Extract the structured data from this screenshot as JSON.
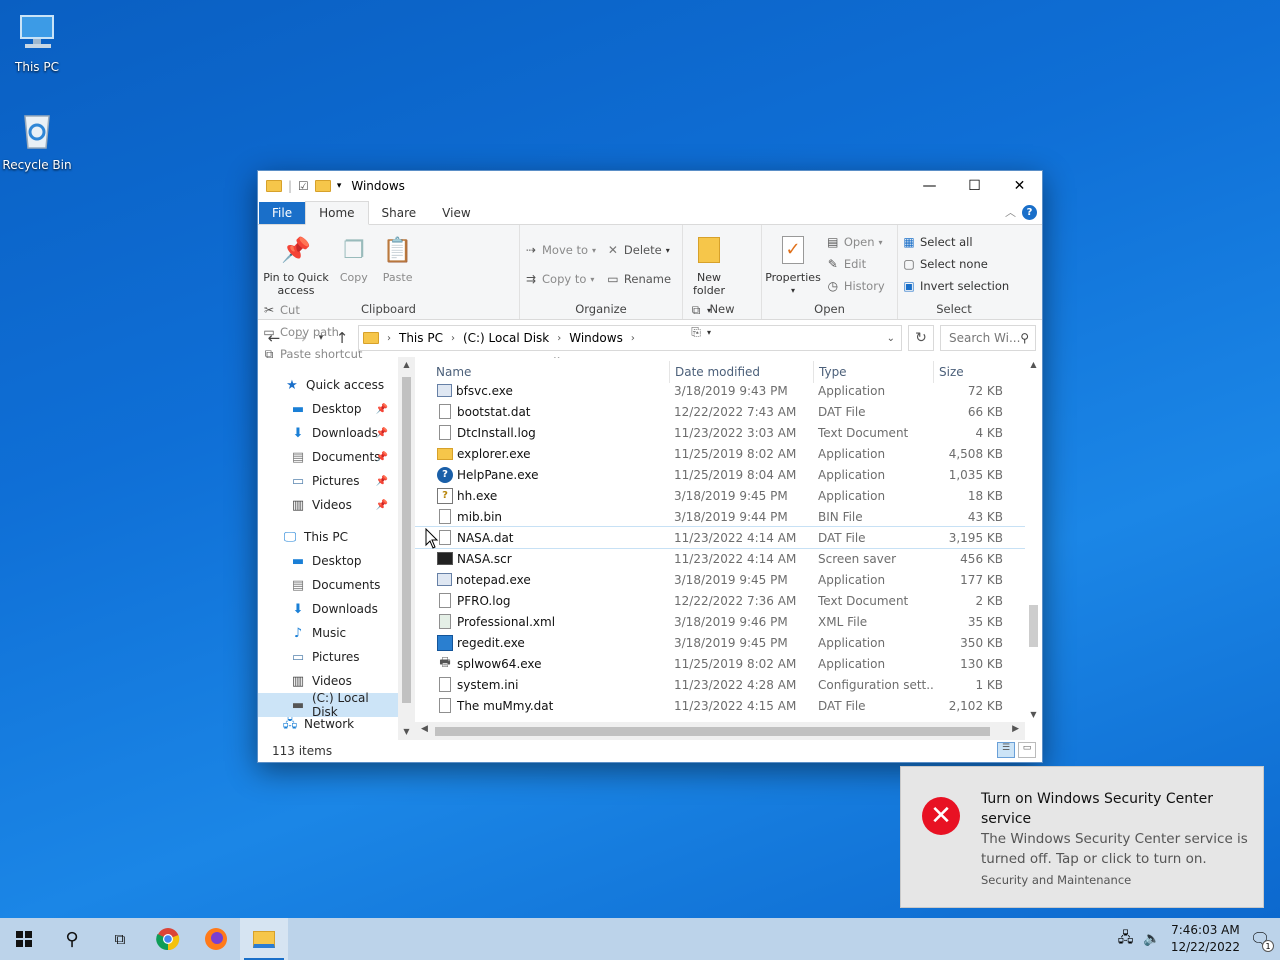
{
  "desktop": {
    "icons": [
      {
        "label": "This PC"
      },
      {
        "label": "Recycle Bin"
      }
    ]
  },
  "window": {
    "title": "Windows",
    "tabs": [
      "File",
      "Home",
      "Share",
      "View"
    ],
    "ribbon": {
      "clipboard": {
        "label": "Clipboard",
        "pin": "Pin to Quick access",
        "copy": "Copy",
        "paste": "Paste",
        "cut": "Cut",
        "copy_path": "Copy path",
        "paste_shortcut": "Paste shortcut"
      },
      "organize": {
        "label": "Organize",
        "move_to": "Move to",
        "copy_to": "Copy to",
        "delete": "Delete",
        "rename": "Rename"
      },
      "new": {
        "label": "New",
        "new_folder": "New folder"
      },
      "open": {
        "label": "Open",
        "properties": "Properties",
        "open": "Open",
        "edit": "Edit",
        "history": "History"
      },
      "select": {
        "label": "Select",
        "select_all": "Select all",
        "select_none": "Select none",
        "invert": "Invert selection"
      }
    },
    "address": {
      "crumbs": [
        "This PC",
        "(C:) Local Disk",
        "Windows"
      ],
      "search_placeholder": "Search Wi..."
    },
    "nav": {
      "quick_access": "Quick access",
      "quick_items": [
        "Desktop",
        "Downloads",
        "Documents",
        "Pictures",
        "Videos"
      ],
      "this_pc": "This PC",
      "pc_items": [
        "Desktop",
        "Documents",
        "Downloads",
        "Music",
        "Pictures",
        "Videos",
        "(C:) Local Disk"
      ],
      "network": "Network"
    },
    "columns": [
      "Name",
      "Date modified",
      "Type",
      "Size"
    ],
    "files": [
      {
        "name": "bfsvc.exe",
        "date": "3/18/2019 9:43 PM",
        "type": "Application",
        "size": "72 KB"
      },
      {
        "name": "bootstat.dat",
        "date": "12/22/2022 7:43 AM",
        "type": "DAT File",
        "size": "66 KB"
      },
      {
        "name": "DtcInstall.log",
        "date": "11/23/2022 3:03 AM",
        "type": "Text Document",
        "size": "4 KB"
      },
      {
        "name": "explorer.exe",
        "date": "11/25/2019 8:02 AM",
        "type": "Application",
        "size": "4,508 KB"
      },
      {
        "name": "HelpPane.exe",
        "date": "11/25/2019 8:04 AM",
        "type": "Application",
        "size": "1,035 KB"
      },
      {
        "name": "hh.exe",
        "date": "3/18/2019 9:45 PM",
        "type": "Application",
        "size": "18 KB"
      },
      {
        "name": "mib.bin",
        "date": "3/18/2019 9:44 PM",
        "type": "BIN File",
        "size": "43 KB"
      },
      {
        "name": "NASA.dat",
        "date": "11/23/2022 4:14 AM",
        "type": "DAT File",
        "size": "3,195 KB"
      },
      {
        "name": "NASA.scr",
        "date": "11/23/2022 4:14 AM",
        "type": "Screen saver",
        "size": "456 KB"
      },
      {
        "name": "notepad.exe",
        "date": "3/18/2019 9:45 PM",
        "type": "Application",
        "size": "177 KB"
      },
      {
        "name": "PFRO.log",
        "date": "12/22/2022 7:36 AM",
        "type": "Text Document",
        "size": "2 KB"
      },
      {
        "name": "Professional.xml",
        "date": "3/18/2019 9:46 PM",
        "type": "XML File",
        "size": "35 KB"
      },
      {
        "name": "regedit.exe",
        "date": "3/18/2019 9:45 PM",
        "type": "Application",
        "size": "350 KB"
      },
      {
        "name": "splwow64.exe",
        "date": "11/25/2019 8:02 AM",
        "type": "Application",
        "size": "130 KB"
      },
      {
        "name": "system.ini",
        "date": "11/23/2022 4:28 AM",
        "type": "Configuration sett...",
        "size": "1 KB"
      },
      {
        "name": "The muMmy.dat",
        "date": "11/23/2022 4:15 AM",
        "type": "DAT File",
        "size": "2,102 KB"
      }
    ],
    "status": "113 items"
  },
  "toast": {
    "title": "Turn on Windows Security Center service",
    "body": "The Windows Security Center service is turned off. Tap or click to turn on.",
    "source": "Security and Maintenance"
  },
  "taskbar": {
    "time": "7:46:03 AM",
    "date": "12/22/2022",
    "notifications": "1"
  }
}
